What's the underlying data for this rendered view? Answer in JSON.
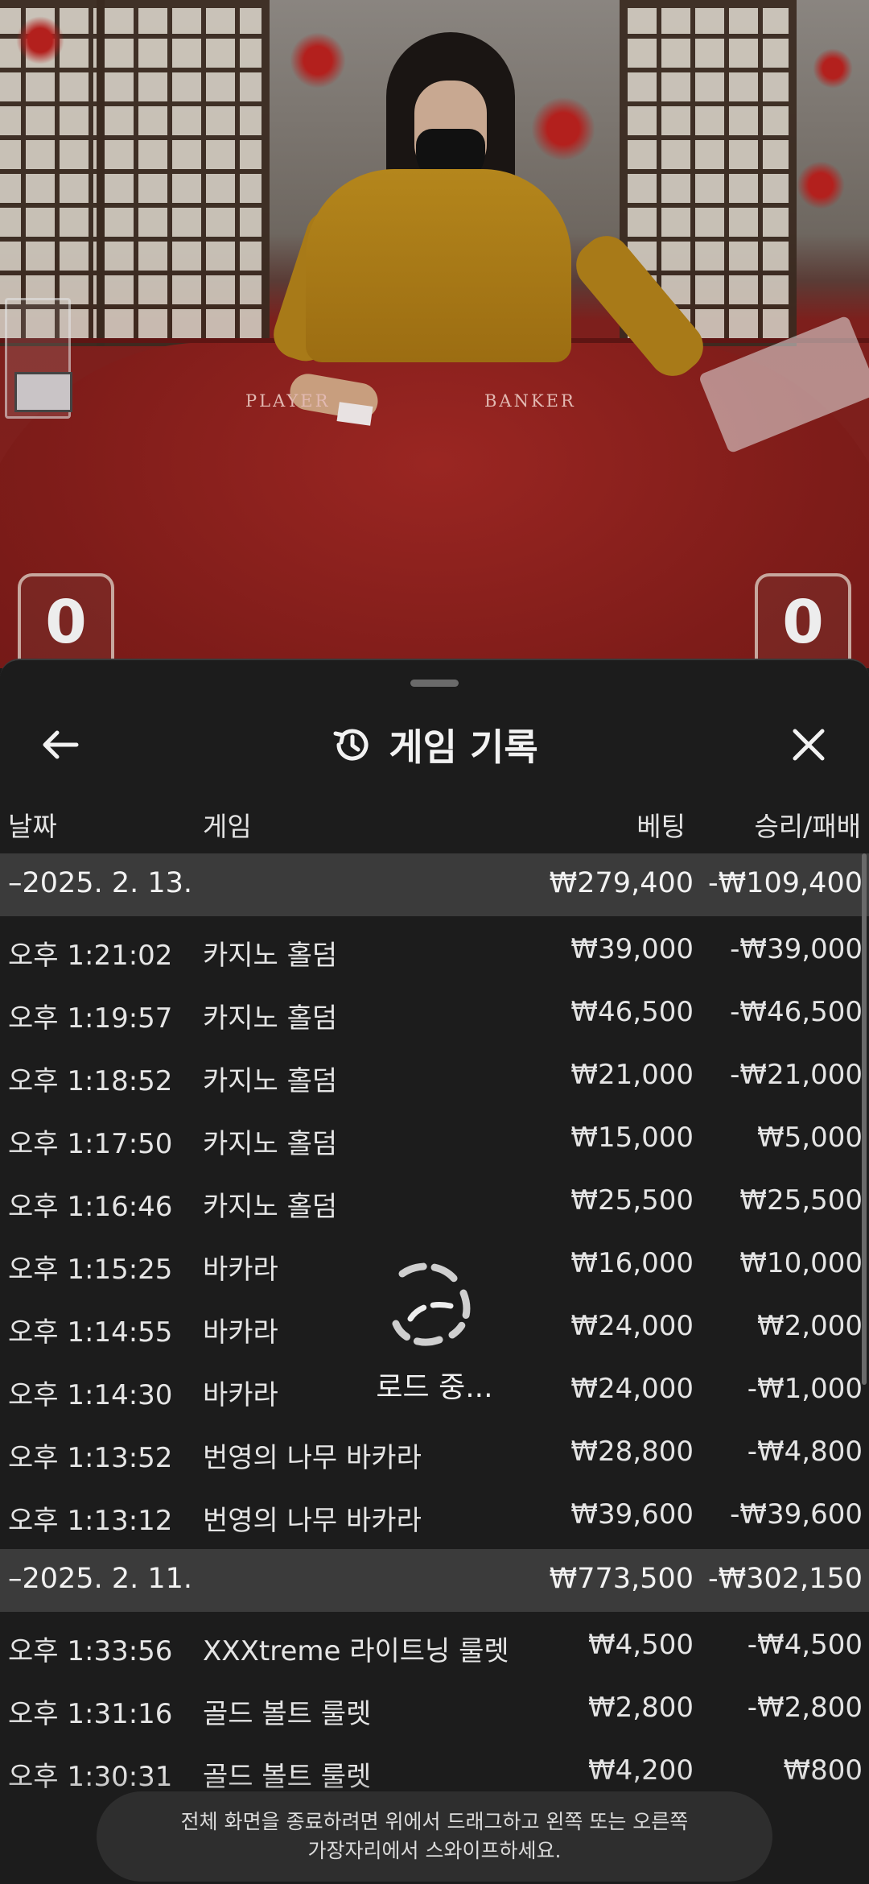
{
  "video": {
    "table_labels": {
      "player": "PLAYER",
      "banker": "BANKER"
    },
    "scores": {
      "player": "0",
      "banker": "0"
    }
  },
  "sheet": {
    "title": "게임 기록",
    "icons": {
      "back": "arrow-left-icon",
      "title": "history-icon",
      "close": "close-icon"
    },
    "columns": {
      "date": "날짜",
      "game": "게임",
      "bet": "베팅",
      "result": "승리/패배"
    },
    "groups": [
      {
        "date": "–2025. 2. 13.",
        "bet_total": "₩279,400",
        "result_total": "-₩109,400",
        "rows": [
          {
            "time": "오후 1:21:02",
            "game": "카지노 홀덤",
            "bet": "₩39,000",
            "result": "-₩39,000"
          },
          {
            "time": "오후 1:19:57",
            "game": "카지노 홀덤",
            "bet": "₩46,500",
            "result": "-₩46,500"
          },
          {
            "time": "오후 1:18:52",
            "game": "카지노 홀덤",
            "bet": "₩21,000",
            "result": "-₩21,000"
          },
          {
            "time": "오후 1:17:50",
            "game": "카지노 홀덤",
            "bet": "₩15,000",
            "result": "₩5,000"
          },
          {
            "time": "오후 1:16:46",
            "game": "카지노 홀덤",
            "bet": "₩25,500",
            "result": "₩25,500"
          },
          {
            "time": "오후 1:15:25",
            "game": "바카라",
            "bet": "₩16,000",
            "result": "₩10,000"
          },
          {
            "time": "오후 1:14:55",
            "game": "바카라",
            "bet": "₩24,000",
            "result": "₩2,000"
          },
          {
            "time": "오후 1:14:30",
            "game": "바카라",
            "bet": "₩24,000",
            "result": "-₩1,000"
          },
          {
            "time": "오후 1:13:52",
            "game": "번영의 나무 바카라",
            "bet": "₩28,800",
            "result": "-₩4,800"
          },
          {
            "time": "오후 1:13:12",
            "game": "번영의 나무 바카라",
            "bet": "₩39,600",
            "result": "-₩39,600"
          }
        ]
      },
      {
        "date": "–2025. 2. 11.",
        "bet_total": "₩773,500",
        "result_total": "-₩302,150",
        "rows": [
          {
            "time": "오후 1:33:56",
            "game": "XXXtreme 라이트닝 룰렛",
            "bet": "₩4,500",
            "result": "-₩4,500"
          },
          {
            "time": "오후 1:31:16",
            "game": "골드 볼트 룰렛",
            "bet": "₩2,800",
            "result": "-₩2,800"
          },
          {
            "time": "오후 1:30:31",
            "game": "골드 볼트 룰렛",
            "bet": "₩4,200",
            "result": "₩800"
          }
        ]
      }
    ],
    "loading_text": "로드 중...",
    "toast": {
      "line1": "전체 화면을 종료하려면 위에서 드래그하고 왼쪽 또는 오른쪽",
      "line2": "가장자리에서 스와이프하세요."
    }
  }
}
